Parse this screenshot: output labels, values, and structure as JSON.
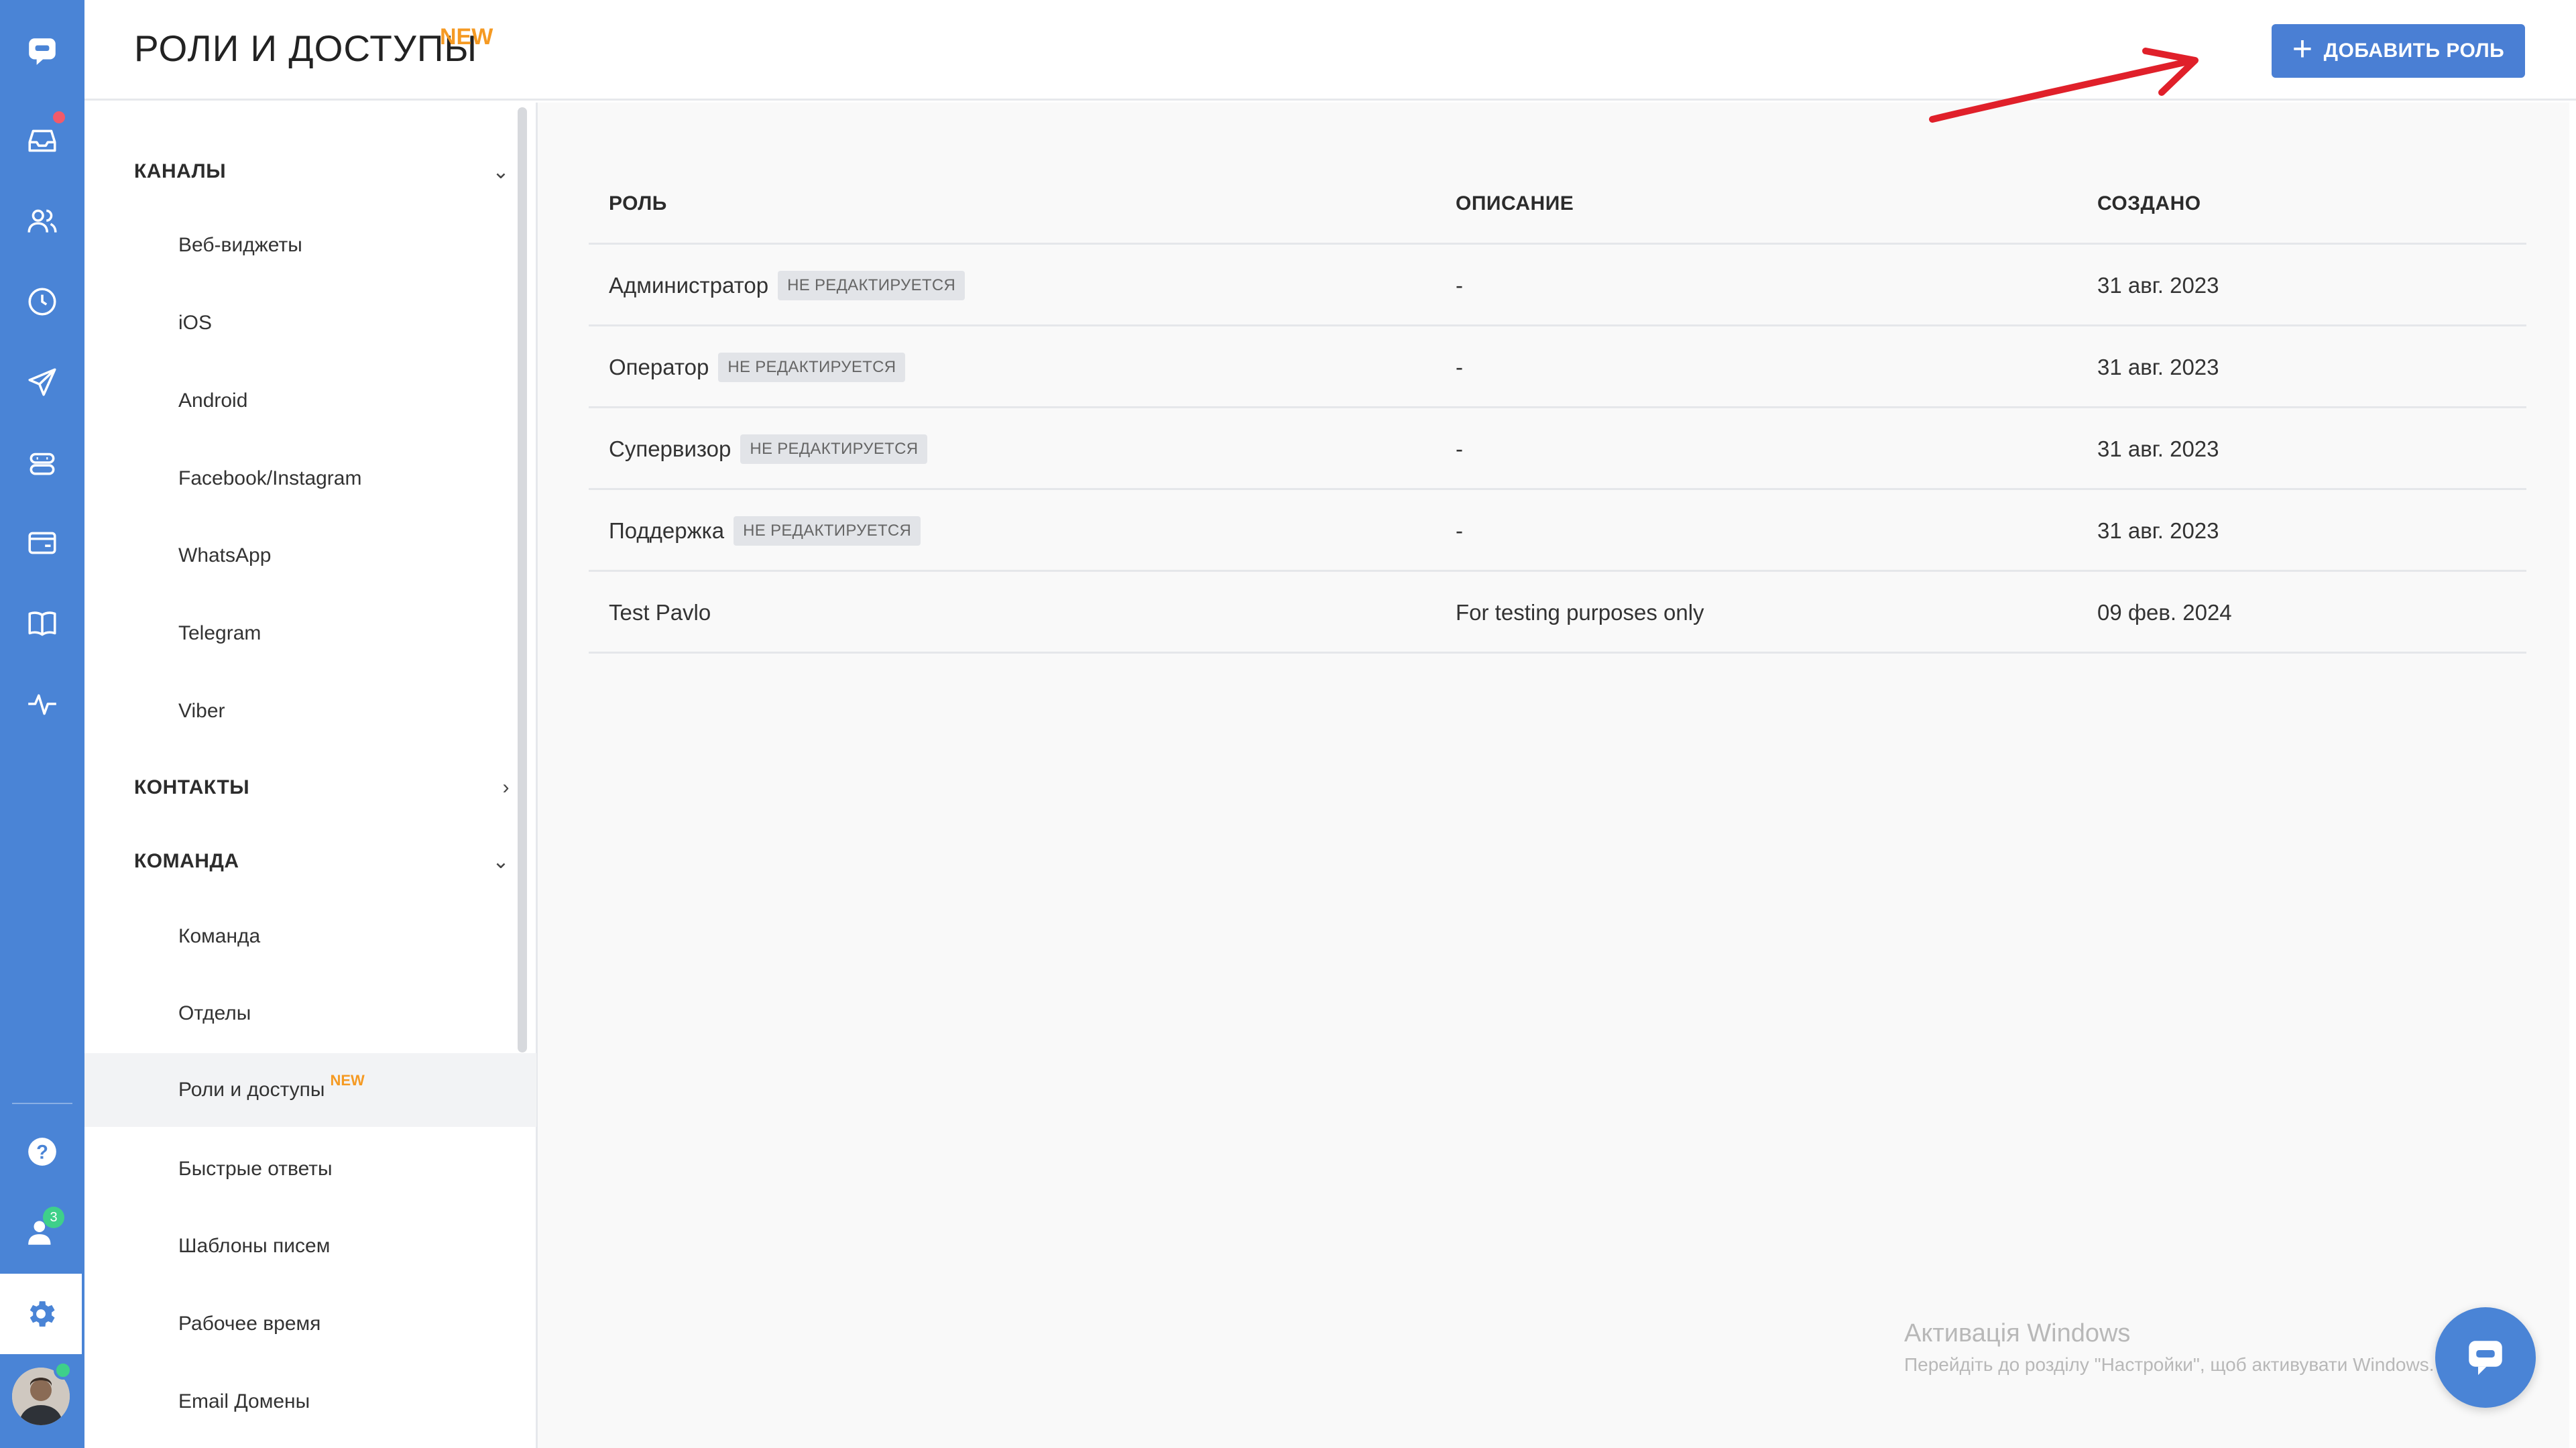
{
  "header": {
    "title": "РОЛИ И ДОСТУПЫ",
    "title_badge": "NEW",
    "add_role_label": "ДОБАВИТЬ РОЛЬ",
    "add_role_icon": "plus-icon"
  },
  "rail": {
    "icons": [
      "app-logo-icon",
      "inbox-icon",
      "contacts-icon",
      "history-icon",
      "send-icon",
      "bot-icon",
      "wallet-icon",
      "book-icon",
      "activity-icon",
      "help-icon",
      "team-icon",
      "settings-icon"
    ],
    "team_badge": "3",
    "colors": {
      "rail": "#4a84d6",
      "notify": "#f25a6a",
      "online": "#3ed08a"
    }
  },
  "sidebar": {
    "sections": [
      {
        "title": "КАНАЛЫ",
        "chevron": "chevron-down-icon",
        "items": [
          "Веб-виджеты",
          "iOS",
          "Android",
          "Facebook/Instagram",
          "WhatsApp",
          "Telegram",
          "Viber"
        ]
      },
      {
        "title": "КОНТАКТЫ",
        "chevron": "chevron-right-icon",
        "items": []
      },
      {
        "title": "КОМАНДА",
        "chevron": "chevron-down-icon",
        "items": [
          "Команда",
          "Отделы",
          "Роли и доступы",
          "Быстрые ответы",
          "Шаблоны писем",
          "Рабочее время",
          "Email Домены"
        ]
      }
    ],
    "active_item": "Роли и доступы",
    "active_badge": "NEW"
  },
  "table": {
    "columns": [
      "РОЛЬ",
      "ОПИСАНИЕ",
      "СОЗДАНО"
    ],
    "rows": [
      {
        "role": "Администратор",
        "tag": "НЕ РЕДАКТИРУЕТСЯ",
        "description": "-",
        "created": "31 авг. 2023"
      },
      {
        "role": "Оператор",
        "tag": "НЕ РЕДАКТИРУЕТСЯ",
        "description": "-",
        "created": "31 авг. 2023"
      },
      {
        "role": "Супервизор",
        "tag": "НЕ РЕДАКТИРУЕТСЯ",
        "description": "-",
        "created": "31 авг. 2023"
      },
      {
        "role": "Поддержка",
        "tag": "НЕ РЕДАКТИРУЕТСЯ",
        "description": "-",
        "created": "31 авг. 2023"
      },
      {
        "role": "Test Pavlo",
        "tag": "",
        "description": "For testing purposes only",
        "created": "09 фев. 2024"
      }
    ]
  },
  "watermark": {
    "line1": "Активація Windows",
    "line2": "Перейдіть до розділу \"Настройки\", щоб активувати Windows."
  },
  "chat_fab_icon": "chat-icon",
  "accent_color": "#4a7fd4",
  "badge_color": "#f59a23",
  "annotation_color": "#e0202a"
}
